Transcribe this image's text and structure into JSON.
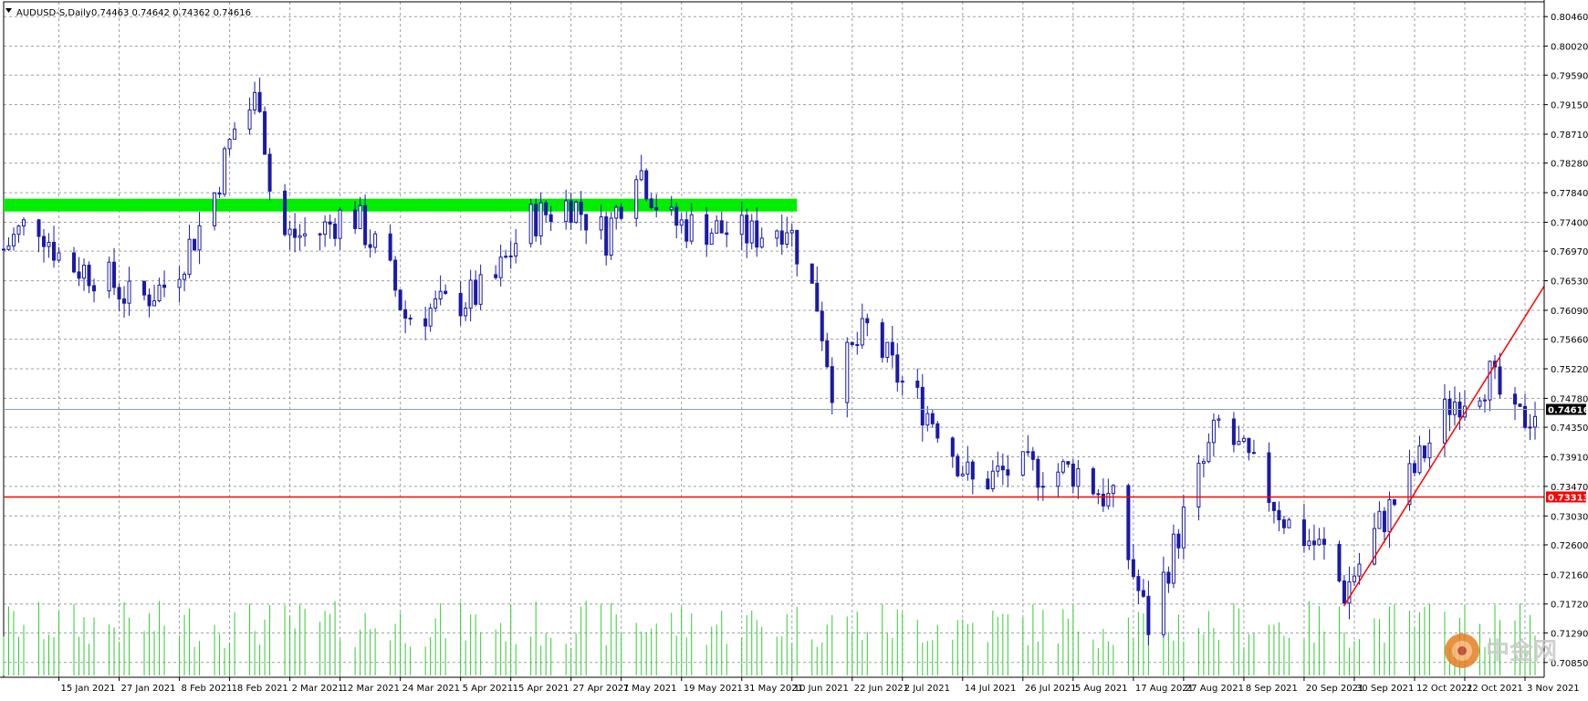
{
  "header": {
    "symbol_label": "AUDUSD-S,Daily",
    "ohlc_text": "0.74463 0.74642 0.74362 0.74616"
  },
  "colors": {
    "background": "#ffffff",
    "grid": "#9aa0a6",
    "bull_candle": "#ffffff",
    "candle_body": "#1a1aa8",
    "volume": "#33cc33",
    "zone": "#00ee00",
    "horizontal_line": "#ff0000",
    "trend_line": "#ff0000",
    "bid_line": "#8aa0b0",
    "bid_tag_bg": "#000000",
    "level_tag_bg": "#ff0000"
  },
  "price_axis_labels": [
    "0.80460",
    "0.80020",
    "0.79590",
    "0.79150",
    "0.78710",
    "0.78280",
    "0.77840",
    "0.77400",
    "0.76970",
    "0.76530",
    "0.76090",
    "0.75660",
    "0.75220",
    "0.74780",
    "0.74350",
    "0.73910",
    "0.73470",
    "0.73030",
    "0.72600",
    "0.72160",
    "0.71720",
    "0.71290",
    "0.70850"
  ],
  "date_axis_labels": [
    "15 Jan 2021",
    "27 Jan 2021",
    "8 Feb 2021",
    "18 Feb 2021",
    "2 Mar 2021",
    "12 Mar 2021",
    "24 Mar 2021",
    "5 Apr 2021",
    "15 Apr 2021",
    "27 Apr 2021",
    "7 May 2021",
    "19 May 2021",
    "31 May 2021",
    "10 Jun 2021",
    "22 Jun 2021",
    "2 Jul 2021",
    "14 Jul 2021",
    "26 Jul 2021",
    "5 Aug 2021",
    "17 Aug 2021",
    "27 Aug 2021",
    "8 Sep 2021",
    "20 Sep 2021",
    "30 Sep 2021",
    "12 Oct 2021",
    "22 Oct 2021",
    "3 Nov 2021"
  ],
  "current_price_tag": "0.74616",
  "horizontal_level_tag": "0.73313",
  "watermark": {
    "text": "中金网",
    "icon": "jinwang-logo-icon"
  },
  "chart_data": {
    "type": "candlestick",
    "title": "AUDUSD-S,Daily",
    "xlabel": "",
    "ylabel": "",
    "ylim": [
      0.7063,
      0.8068
    ],
    "grid": true,
    "current_price": 0.74616,
    "horizontal_level": 0.73313,
    "supply_zone": {
      "from": 0.7756,
      "to": 0.7775,
      "start": "4 Jan 2021",
      "end": "11 Jun 2021"
    },
    "trend_line": {
      "start_date": "28 Sep 2021",
      "start_price": 0.717,
      "end_date": "5 Nov 2021",
      "end_price": 0.7645
    },
    "x_range": [
      "4 Jan 2021",
      "5 Nov 2021"
    ],
    "anchors": [
      {
        "date": "4 Jan 2021",
        "price": 0.77
      },
      {
        "date": "10 Jan 2021",
        "price": 0.775
      },
      {
        "date": "16 Jan 2021",
        "price": 0.768
      },
      {
        "date": "24 Jan 2021",
        "price": 0.766
      },
      {
        "date": "30 Jan 2021",
        "price": 0.762
      },
      {
        "date": "6 Feb 2021",
        "price": 0.765
      },
      {
        "date": "14 Feb 2021",
        "price": 0.776
      },
      {
        "date": "19 Feb 2021",
        "price": 0.788
      },
      {
        "date": "24 Feb 2021",
        "price": 0.793
      },
      {
        "date": "27 Feb 2021",
        "price": 0.772
      },
      {
        "date": "7 Mar 2021",
        "price": 0.772
      },
      {
        "date": "14 Mar 2021",
        "price": 0.776
      },
      {
        "date": "21 Mar 2021",
        "price": 0.768
      },
      {
        "date": "25 Mar 2021",
        "price": 0.76
      },
      {
        "date": "4 Apr 2021",
        "price": 0.762
      },
      {
        "date": "11 Apr 2021",
        "price": 0.764
      },
      {
        "date": "18 Apr 2021",
        "price": 0.774
      },
      {
        "date": "27 Apr 2021",
        "price": 0.777
      },
      {
        "date": "4 May 2021",
        "price": 0.772
      },
      {
        "date": "10 May 2021",
        "price": 0.783
      },
      {
        "date": "16 May 2021",
        "price": 0.774
      },
      {
        "date": "25 May 2021",
        "price": 0.773
      },
      {
        "date": "2 Jun 2021",
        "price": 0.772
      },
      {
        "date": "9 Jun 2021",
        "price": 0.774
      },
      {
        "date": "15 Jun 2021",
        "price": 0.762
      },
      {
        "date": "18 Jun 2021",
        "price": 0.75
      },
      {
        "date": "25 Jun 2021",
        "price": 0.758
      },
      {
        "date": "2 Jul 2021",
        "price": 0.75
      },
      {
        "date": "9 Jul 2021",
        "price": 0.744
      },
      {
        "date": "16 Jul 2021",
        "price": 0.735
      },
      {
        "date": "23 Jul 2021",
        "price": 0.737
      },
      {
        "date": "30 Jul 2021",
        "price": 0.737
      },
      {
        "date": "6 Aug 2021",
        "price": 0.737
      },
      {
        "date": "13 Aug 2021",
        "price": 0.732
      },
      {
        "date": "20 Aug 2021",
        "price": 0.714
      },
      {
        "date": "27 Aug 2021",
        "price": 0.73
      },
      {
        "date": "3 Sep 2021",
        "price": 0.744
      },
      {
        "date": "10 Sep 2021",
        "price": 0.737
      },
      {
        "date": "17 Sep 2021",
        "price": 0.729
      },
      {
        "date": "24 Sep 2021",
        "price": 0.725
      },
      {
        "date": "28 Sep 2021",
        "price": 0.719
      },
      {
        "date": "5 Oct 2021",
        "price": 0.729
      },
      {
        "date": "12 Oct 2021",
        "price": 0.737
      },
      {
        "date": "19 Oct 2021",
        "price": 0.747
      },
      {
        "date": "27 Oct 2021",
        "price": 0.751
      },
      {
        "date": "1 Nov 2021",
        "price": 0.744
      },
      {
        "date": "5 Nov 2021",
        "price": 0.746
      }
    ]
  }
}
